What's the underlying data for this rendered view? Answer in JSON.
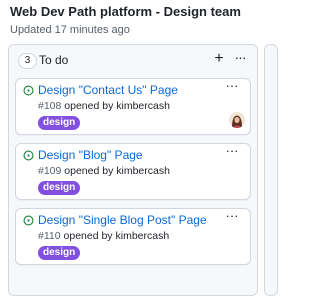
{
  "project": {
    "title": "Web Dev Path platform - Design team",
    "updated": "Updated 17 minutes ago"
  },
  "column": {
    "count": "3",
    "name": "To do",
    "add_glyph": "+",
    "more_glyph": "···"
  },
  "cards": [
    {
      "title": "Design \"Contact Us\" Page",
      "number": "#108",
      "opened_by_text": " opened by ",
      "author": "kimbercash",
      "label": "design",
      "more_glyph": "···",
      "icon": "issue-opened-icon",
      "has_assignee_avatar": true
    },
    {
      "title": "Design \"Blog\" Page",
      "number": "#109",
      "opened_by_text": " opened by ",
      "author": "kimbercash",
      "label": "design",
      "more_glyph": "···",
      "icon": "issue-opened-icon",
      "has_assignee_avatar": false
    },
    {
      "title": "Design \"Single Blog Post\" Page",
      "number": "#110",
      "opened_by_text": " opened by ",
      "author": "kimbercash",
      "label": "design",
      "more_glyph": "···",
      "icon": "issue-opened-icon",
      "has_assignee_avatar": false
    }
  ],
  "colors": {
    "issue_open_green": "#1a7f37",
    "link_blue": "#0969da",
    "label_purple": "#8250df",
    "border": "#d0d7de",
    "column_bg": "#f6f8fa"
  }
}
